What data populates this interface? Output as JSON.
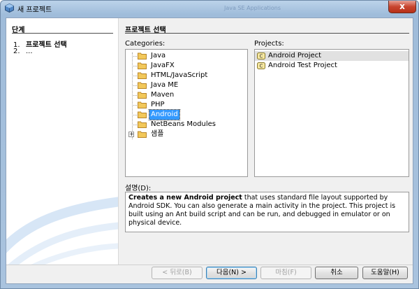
{
  "window": {
    "title": "새 프로젝트",
    "background_title": "Java SE Applications",
    "close_symbol": "x"
  },
  "steps": {
    "title": "단계",
    "items": [
      {
        "num": "1.",
        "label": "프로젝트 선택"
      },
      {
        "num": "2.",
        "label": "..."
      }
    ]
  },
  "main": {
    "title": "프로젝트 선택",
    "categories_label": "Categories:",
    "projects_label": "Projects:",
    "description_label": "설명(D):",
    "categories": [
      {
        "label": "Java"
      },
      {
        "label": "JavaFX"
      },
      {
        "label": "HTML/JavaScript"
      },
      {
        "label": "Java ME"
      },
      {
        "label": "Maven"
      },
      {
        "label": "PHP"
      },
      {
        "label": "Android"
      },
      {
        "label": "NetBeans Modules"
      },
      {
        "label": "샘플"
      }
    ],
    "selected_category": "Android",
    "expander_symbol": "+",
    "projects": [
      {
        "label": "Android Project"
      },
      {
        "label": "Android Test Project"
      }
    ],
    "selected_project": "Android Project",
    "description_bold": "Creates a new Android project",
    "description_rest": " that uses standard file layout supported by Android SDK. You can also generate a main activity in the project. This project is built using an Ant build script and can be run, and debugged in emulator or on physical device."
  },
  "buttons": {
    "back": "< 뒤로(B)",
    "next": "다음(N) >",
    "finish": "마침(F)",
    "cancel": "취소",
    "help": "도움말(H)"
  },
  "colors": {
    "selection": "#3399ff",
    "title_bar": "#bcd3ea",
    "close_button": "#c8452f"
  }
}
